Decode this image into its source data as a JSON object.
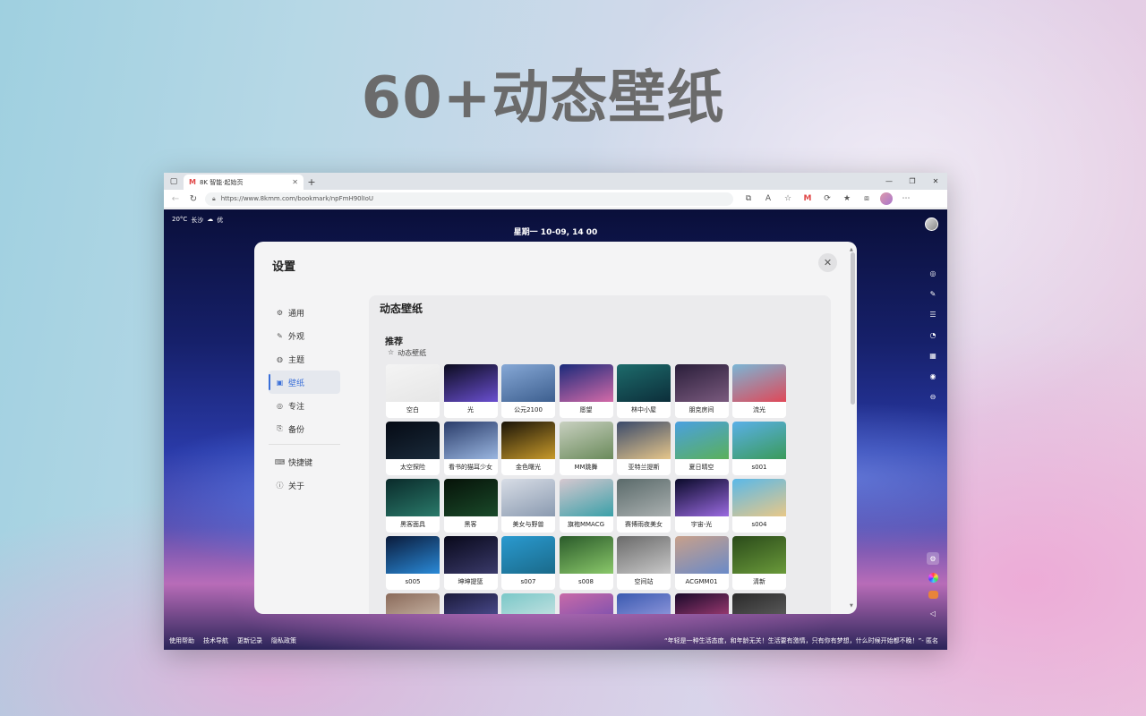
{
  "promo": {
    "title": "60+动态壁纸"
  },
  "browser": {
    "tab": {
      "favicon": "M",
      "title": "8K 智能·起始页",
      "close": "✕"
    },
    "new_tab": "+",
    "window_controls": [
      "—",
      "❐",
      "✕"
    ],
    "address": {
      "url": "https://www.8kmm.com/bookmark/npFmH90lIoU",
      "lock_icon": "lock-icon"
    }
  },
  "startpage": {
    "weather": {
      "temp": "20°C",
      "city": "长沙",
      "icon": "cloud-icon",
      "quality": "优"
    },
    "datetime": "星期一 10-09, 14 00",
    "footer_links": [
      "使用帮助",
      "技术导航",
      "更新记录",
      "隐私政策"
    ],
    "quote": "“年轻是一种生活态度，和年龄无关！生活要有激情，只有你有梦想，什么时候开始都不晚！”- 匿名"
  },
  "settings": {
    "title": "设置",
    "close": "✕",
    "nav": [
      {
        "label": "通用",
        "icon": "gear-icon",
        "glyph": "⚙"
      },
      {
        "label": "外观",
        "icon": "brush-icon",
        "glyph": "✎"
      },
      {
        "label": "主题",
        "icon": "palette-icon",
        "glyph": "◍"
      },
      {
        "label": "壁纸",
        "icon": "image-icon",
        "glyph": "▣",
        "active": true
      },
      {
        "label": "专注",
        "icon": "target-icon",
        "glyph": "◎"
      },
      {
        "label": "备份",
        "icon": "backup-icon",
        "glyph": "⎘"
      },
      {
        "label": "快捷键",
        "icon": "keyboard-icon",
        "glyph": "⌨"
      },
      {
        "label": "关于",
        "icon": "info-icon",
        "glyph": "ⓘ"
      }
    ],
    "panel": {
      "title": "动态壁纸",
      "group_title": "推荐",
      "group_sub": "动态壁纸",
      "group_sub_icon": "star-icon",
      "wallpapers": [
        {
          "label": "空白",
          "colors": [
            "#f4f4f4",
            "#e6e6e6"
          ]
        },
        {
          "label": "光",
          "colors": [
            "#0b0b1e",
            "#6a4fd0"
          ]
        },
        {
          "label": "公元2100",
          "colors": [
            "#86a8d6",
            "#3d5f8f"
          ]
        },
        {
          "label": "愿望",
          "colors": [
            "#1a2a7a",
            "#d46aa8"
          ]
        },
        {
          "label": "林中小屋",
          "colors": [
            "#1d6b6b",
            "#0c2e3a"
          ]
        },
        {
          "label": "朋克房间",
          "colors": [
            "#2a1e3a",
            "#7a5a7e"
          ]
        },
        {
          "label": "流光",
          "colors": [
            "#7ab6d6",
            "#e04858"
          ]
        },
        {
          "label": "太空探险",
          "colors": [
            "#050a14",
            "#1a2a3a"
          ]
        },
        {
          "label": "看书的猫耳少女",
          "colors": [
            "#2a3c6a",
            "#9ab6e0"
          ]
        },
        {
          "label": "金色曙光",
          "colors": [
            "#1a1408",
            "#c89a2a"
          ]
        },
        {
          "label": "MM跳舞",
          "colors": [
            "#c8d0c0",
            "#6a8a5a"
          ]
        },
        {
          "label": "亚特兰提斯",
          "colors": [
            "#3a4a6a",
            "#e6c68a"
          ]
        },
        {
          "label": "夏日晴空",
          "colors": [
            "#4aa0e0",
            "#5ab05a"
          ]
        },
        {
          "label": "s001",
          "colors": [
            "#5ab0e8",
            "#3a9a5a"
          ]
        },
        {
          "label": "黑客面具",
          "colors": [
            "#0a2a2a",
            "#2a7a6a"
          ]
        },
        {
          "label": "黑客",
          "colors": [
            "#061208",
            "#1a4a2a"
          ]
        },
        {
          "label": "美女与野兽",
          "colors": [
            "#d8dde6",
            "#8a9ab0"
          ]
        },
        {
          "label": "旗袍MMACG",
          "colors": [
            "#d6c8d0",
            "#3aa0a8"
          ]
        },
        {
          "label": "赛博雨夜美女",
          "colors": [
            "#5a6a6a",
            "#aab0b0"
          ]
        },
        {
          "label": "宇宙-光",
          "colors": [
            "#0a0a2a",
            "#9a6ae0"
          ]
        },
        {
          "label": "s004",
          "colors": [
            "#5ab8e8",
            "#e8c888"
          ]
        },
        {
          "label": "s005",
          "colors": [
            "#0a1a3a",
            "#2a8ad8"
          ]
        },
        {
          "label": "坤坤提篮",
          "colors": [
            "#08081a",
            "#3a3a6a"
          ]
        },
        {
          "label": "s007",
          "colors": [
            "#2a9ad0",
            "#1a6a8a"
          ]
        },
        {
          "label": "s008",
          "colors": [
            "#2a5a2a",
            "#8ac86a"
          ]
        },
        {
          "label": "空间站",
          "colors": [
            "#6a6a6a",
            "#c8c8c8"
          ]
        },
        {
          "label": "ACGMM01",
          "colors": [
            "#c8a08a",
            "#6a8ac8"
          ]
        },
        {
          "label": "清新",
          "colors": [
            "#2a4a1a",
            "#6a9a3a"
          ]
        },
        {
          "label": "",
          "colors": [
            "#8a6a5a",
            "#d8c8b8"
          ]
        },
        {
          "label": "",
          "colors": [
            "#1a1a3a",
            "#5a5aa8"
          ]
        },
        {
          "label": "",
          "colors": [
            "#7ac8c8",
            "#d8e8e8"
          ]
        },
        {
          "label": "",
          "colors": [
            "#c86aa8",
            "#6a4ab0"
          ]
        },
        {
          "label": "",
          "colors": [
            "#3a5ab0",
            "#a8a8e8"
          ]
        },
        {
          "label": "",
          "colors": [
            "#1a0a2a",
            "#c84a8a"
          ]
        },
        {
          "label": "",
          "colors": [
            "#2a2a2a",
            "#6a6a6a"
          ]
        }
      ]
    }
  },
  "right_dock": [
    "globe-icon",
    "note-icon",
    "list-icon",
    "bell-icon",
    "calendar-icon",
    "compass-icon",
    "minus-circle-icon"
  ],
  "right_dock_bottom": [
    "settings-icon",
    "color-wheel-icon",
    "wallpaper-icon",
    "volume-icon"
  ]
}
